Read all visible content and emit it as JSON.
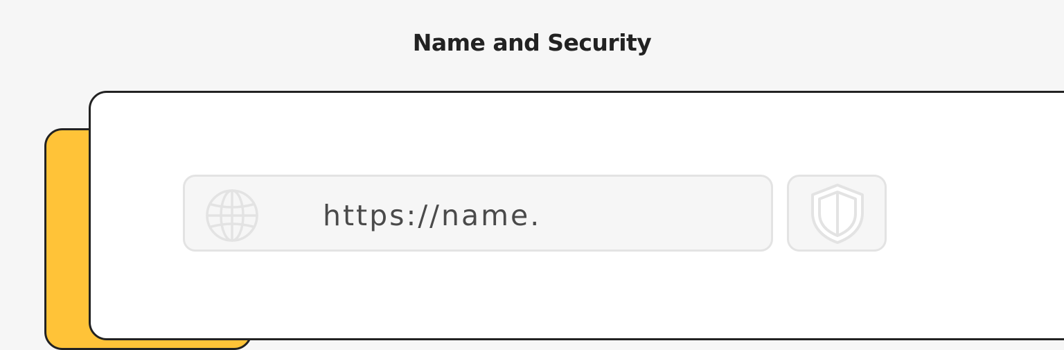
{
  "header": {
    "title": "Name and Security"
  },
  "url_field": {
    "value": "https://name.",
    "leading_icon": "globe-icon"
  },
  "security_button": {
    "icon": "shield-icon"
  },
  "colors": {
    "accent": "#FFC338",
    "outline": "#222222",
    "field_border": "#E3E3E3",
    "field_fill": "#F6F6F6",
    "page_background": "#F6F6F6",
    "card_background": "#FFFFFF",
    "text": "#4A4A4A"
  }
}
